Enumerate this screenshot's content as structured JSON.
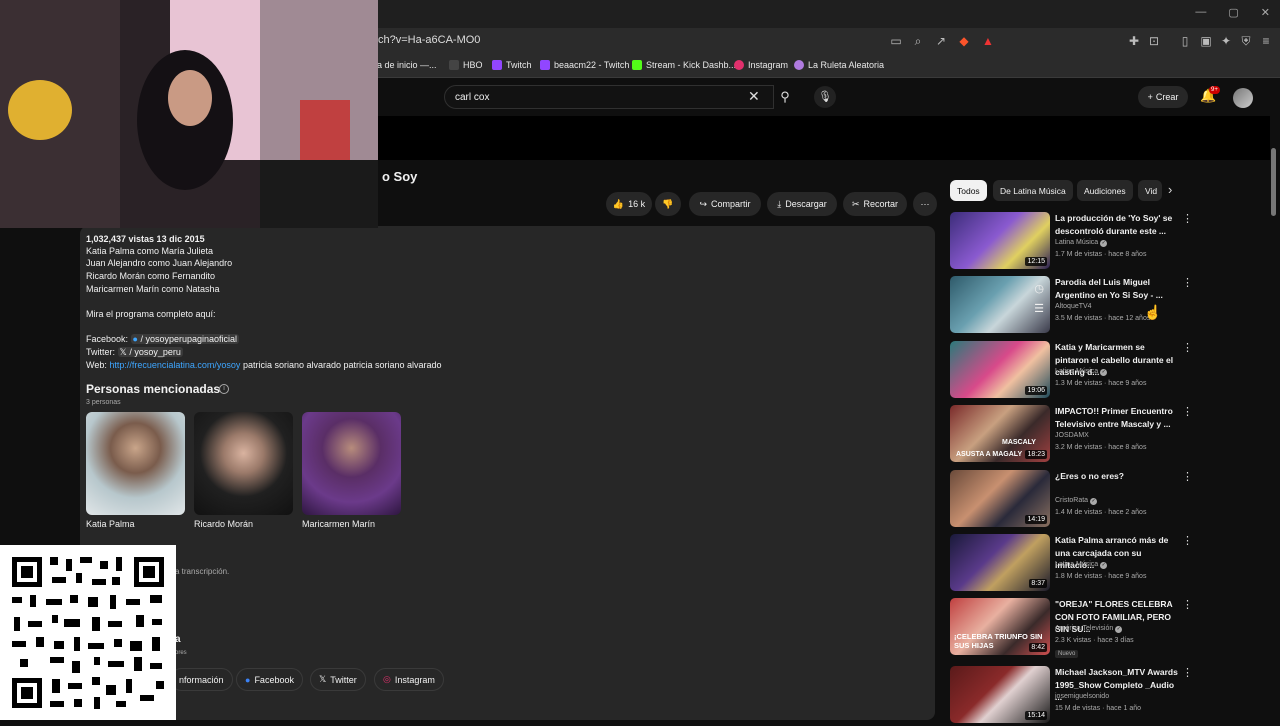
{
  "browser": {
    "url": "ch?v=Ha-a6CA-MO0",
    "bookmarks": [
      {
        "label": "na de inicio —...",
        "color": "#555"
      },
      {
        "label": "HBO",
        "color": "#222"
      },
      {
        "label": "Twitch",
        "color": "#9146ff"
      },
      {
        "label": "beaacm22 - Twitch",
        "color": "#9146ff"
      },
      {
        "label": "Stream - Kick Dashb...",
        "color": "#53fc18"
      },
      {
        "label": "Instagram",
        "color": "#e1306c"
      },
      {
        "label": "La Ruleta Aleatoria",
        "color": "#b07be0"
      }
    ]
  },
  "header": {
    "search_value": "carl cox",
    "create_label": "Crear",
    "notif_badge": "9+"
  },
  "video": {
    "title_partial": "o Soy",
    "likes": "16 k",
    "share": "Compartir",
    "download": "Descargar",
    "clip": "Recortar"
  },
  "description": {
    "stats": "1,032,437 vistas  13 dic 2015",
    "cast": [
      "Katia Palma como María Julieta",
      "Juan Alejandro como Juan Alejandro",
      "Ricardo Morán como Fernandito",
      "Maricarmen Marín como Natasha"
    ],
    "program_line": "Mira el programa completo aquí:",
    "facebook_label": "Facebook:",
    "facebook_handle": "/ yosoyperupaginaoficial",
    "twitter_label": "Twitter:",
    "twitter_handle": "/ yosoy_peru",
    "web_label": "Web:",
    "web_link": "http://frecuencialatina.com/yosoy",
    "web_tail": " patricia soriano alvarado patricia soriano alvarado",
    "mentioned_title": "Personas mencionadas",
    "mentioned_count": "3 personas",
    "people": [
      "Katia Palma",
      "Ricardo Morán",
      "Maricarmen Marín"
    ],
    "transcript_partial": "a transcripción.",
    "section_partial": "a",
    "section_sub_partial": "ores",
    "social_buttons": [
      "nformación",
      "Facebook",
      "Twitter",
      "Instagram"
    ]
  },
  "sidebar": {
    "filters": [
      "Todos",
      "De Latina Música",
      "Audiciones",
      "Vid"
    ],
    "recommendations": [
      {
        "title": "La producción de 'Yo Soy' se descontroló durante este ...",
        "channel": "Latina Música",
        "verified": true,
        "meta": "1.7 M de vistas · hace 8 años",
        "duration": "12:15",
        "badge": ""
      },
      {
        "title": "Parodia del Luis Miguel Argentino en Yo Si Soy - ...",
        "channel": "AltoqueTV4",
        "verified": false,
        "meta": "3.5 M de vistas · hace 12 años",
        "duration": "",
        "badge": ""
      },
      {
        "title": "Katia y Maricarmen se pintaron el cabello durante el casting d...",
        "channel": "Latina Música",
        "verified": true,
        "meta": "1.3 M de vistas · hace 9 años",
        "duration": "19:06",
        "badge": ""
      },
      {
        "title": "IMPACTO!! Primer Encuentro Televisivo entre Mascaly y ...",
        "channel": "JOSDAMX",
        "verified": false,
        "meta": "3.2 M de vistas · hace 8 años",
        "duration": "18:23",
        "badge": ""
      },
      {
        "title": "¿Eres o no eres?",
        "channel": "CristoRata",
        "verified": true,
        "meta": "1.4 M de vistas · hace 2 años",
        "duration": "14:19",
        "badge": ""
      },
      {
        "title": "Katia Palma arrancó más de una carcajada con su imitació...",
        "channel": "Latina Música",
        "verified": true,
        "meta": "1.8 M de vistas · hace 9 años",
        "duration": "8:37",
        "badge": ""
      },
      {
        "title": "\"OREJA\" FLORES CELEBRA CON FOTO FAMILIAR, PERO SIN SU...",
        "channel": "América Televisión",
        "verified": true,
        "meta": "2.3 K vistas · hace 3 días",
        "duration": "8:42",
        "badge": "Nuevo"
      },
      {
        "title": "Michael Jackson_MTV Awards 1995_Show Completo _Audio ...",
        "channel": "josemiguelsonido",
        "verified": false,
        "meta": "15 M de vistas · hace 1 año",
        "duration": "15:14",
        "badge": ""
      }
    ],
    "thumb_texts": [
      "MASCALY",
      "ASUSTA A MAGALY",
      "¡CELEBRA TRIUNFO SIN SUS HIJAS"
    ]
  }
}
